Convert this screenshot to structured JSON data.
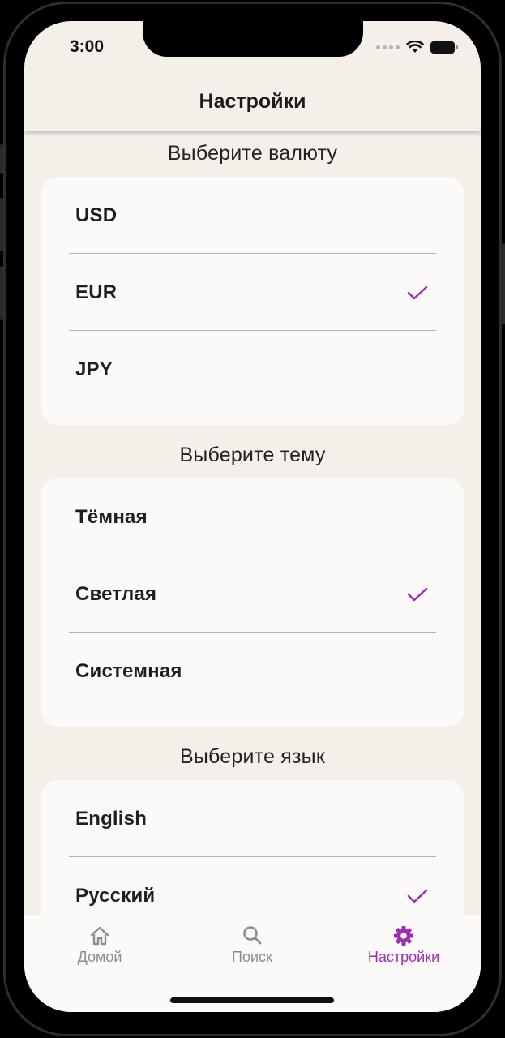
{
  "status_bar": {
    "time": "3:00"
  },
  "header": {
    "title": "Настройки"
  },
  "currency": {
    "title": "Выберите валюту",
    "options": [
      "USD",
      "EUR",
      "JPY"
    ],
    "selected": "EUR"
  },
  "theme": {
    "title": "Выберите тему",
    "options": [
      "Тёмная",
      "Светлая",
      "Системная"
    ],
    "selected": "Светлая"
  },
  "language": {
    "title": "Выберите язык",
    "options": [
      "English",
      "Русский"
    ],
    "selected": "Русский"
  },
  "tabs": [
    {
      "label": "Домой",
      "icon": "home-icon",
      "active": false
    },
    {
      "label": "Поиск",
      "icon": "search-icon",
      "active": false
    },
    {
      "label": "Настройки",
      "icon": "gear-icon",
      "active": true
    }
  ],
  "colors": {
    "accent": "#9b2fae",
    "background": "#f4efe9",
    "card": "#fbfaf8",
    "inactive_tab": "#8d8d8d"
  }
}
